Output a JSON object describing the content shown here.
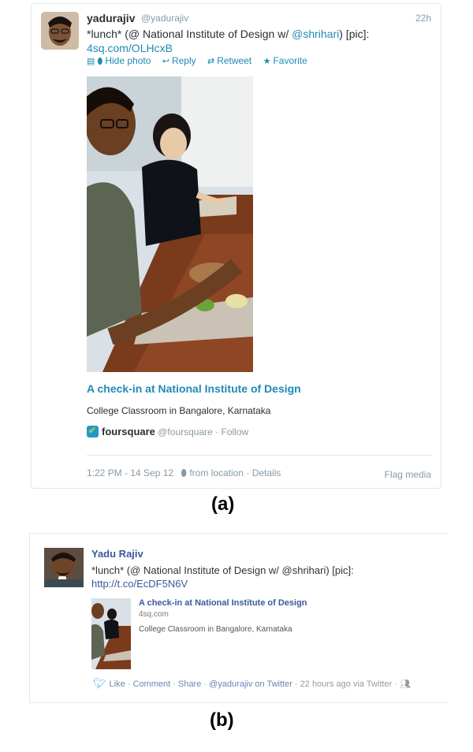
{
  "tweet": {
    "display_name": "yadurajiv",
    "handle": "@yadurajiv",
    "time_ago": "22h",
    "text_prefix": "*lunch* (@ National Institute of Design w/ ",
    "mention": "@shrihari",
    "text_suffix": ") [pic]:",
    "link": "4sq.com/OLHcxB",
    "actions": {
      "hide_photo": "Hide photo",
      "reply": "Reply",
      "retweet": "Retweet",
      "favorite": "Favorite"
    },
    "card": {
      "title": "A check-in at National Institute of Design",
      "description": "College Classroom in Bangalore, Karnataka",
      "source_name": "foursquare",
      "source_handle": "@foursquare",
      "follow": "· Follow"
    },
    "meta": {
      "timestamp": "1:22 PM - 14 Sep 12",
      "location": "from location",
      "details": "· Details",
      "flag_media": "Flag media"
    }
  },
  "label_a": "(a)",
  "fb_post": {
    "author": "Yadu Rajiv",
    "text": "*lunch* (@ National Institute of Design w/ @shrihari) [pic]:",
    "link": "http://t.co/EcDF5N6V",
    "attachment": {
      "title": "A check-in at National Institute of Design",
      "domain": "4sq.com",
      "description": "College Classroom in Bangalore, Karnataka"
    },
    "actions": {
      "like": "Like",
      "comment": "Comment",
      "share": "Share",
      "via_user": "@yadurajiv on Twitter",
      "time": "22 hours ago via Twitter"
    }
  },
  "label_b": "(b)",
  "colors": {
    "twitter_link": "#1f8ab5",
    "facebook_link": "#3b5998",
    "muted": "#8899a6"
  }
}
